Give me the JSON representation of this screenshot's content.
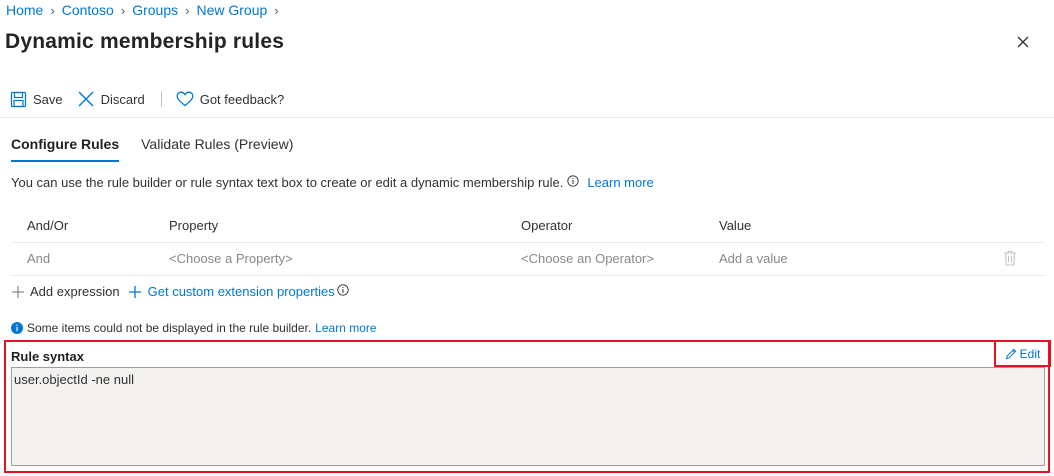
{
  "breadcrumb": [
    {
      "label": "Home"
    },
    {
      "label": "Contoso"
    },
    {
      "label": "Groups"
    },
    {
      "label": "New Group"
    }
  ],
  "page": {
    "title": "Dynamic membership rules"
  },
  "toolbar": {
    "save_label": "Save",
    "discard_label": "Discard",
    "feedback_label": "Got feedback?"
  },
  "tabs": [
    {
      "label": "Configure Rules",
      "active": true
    },
    {
      "label": "Validate Rules (Preview)",
      "active": false
    }
  ],
  "description": {
    "text": "You can use the rule builder or rule syntax text box to create or edit a dynamic membership rule.",
    "learn_more": "Learn more"
  },
  "table": {
    "headers": [
      "And/Or",
      "Property",
      "Operator",
      "Value"
    ],
    "rows": [
      {
        "and_or": "And",
        "property": "<Choose a Property>",
        "operator": "<Choose an Operator>",
        "value": "Add a value"
      }
    ]
  },
  "actions": {
    "add_expression": "Add expression",
    "custom_extension": "Get custom extension properties"
  },
  "warning": {
    "text": "Some items could not be displayed in the rule builder.",
    "learn_more": "Learn more"
  },
  "rule_syntax": {
    "label": "Rule syntax",
    "edit_label": "Edit",
    "value": "user.objectId -ne null"
  },
  "colors": {
    "accent": "#0078d4",
    "highlight_border": "#e81123",
    "textbox_bg": "#f3f2f1"
  },
  "icons": [
    "save-icon",
    "discard-icon",
    "heart-icon",
    "close-icon",
    "info-icon",
    "trash-icon",
    "plus-icon",
    "pencil-icon"
  ]
}
